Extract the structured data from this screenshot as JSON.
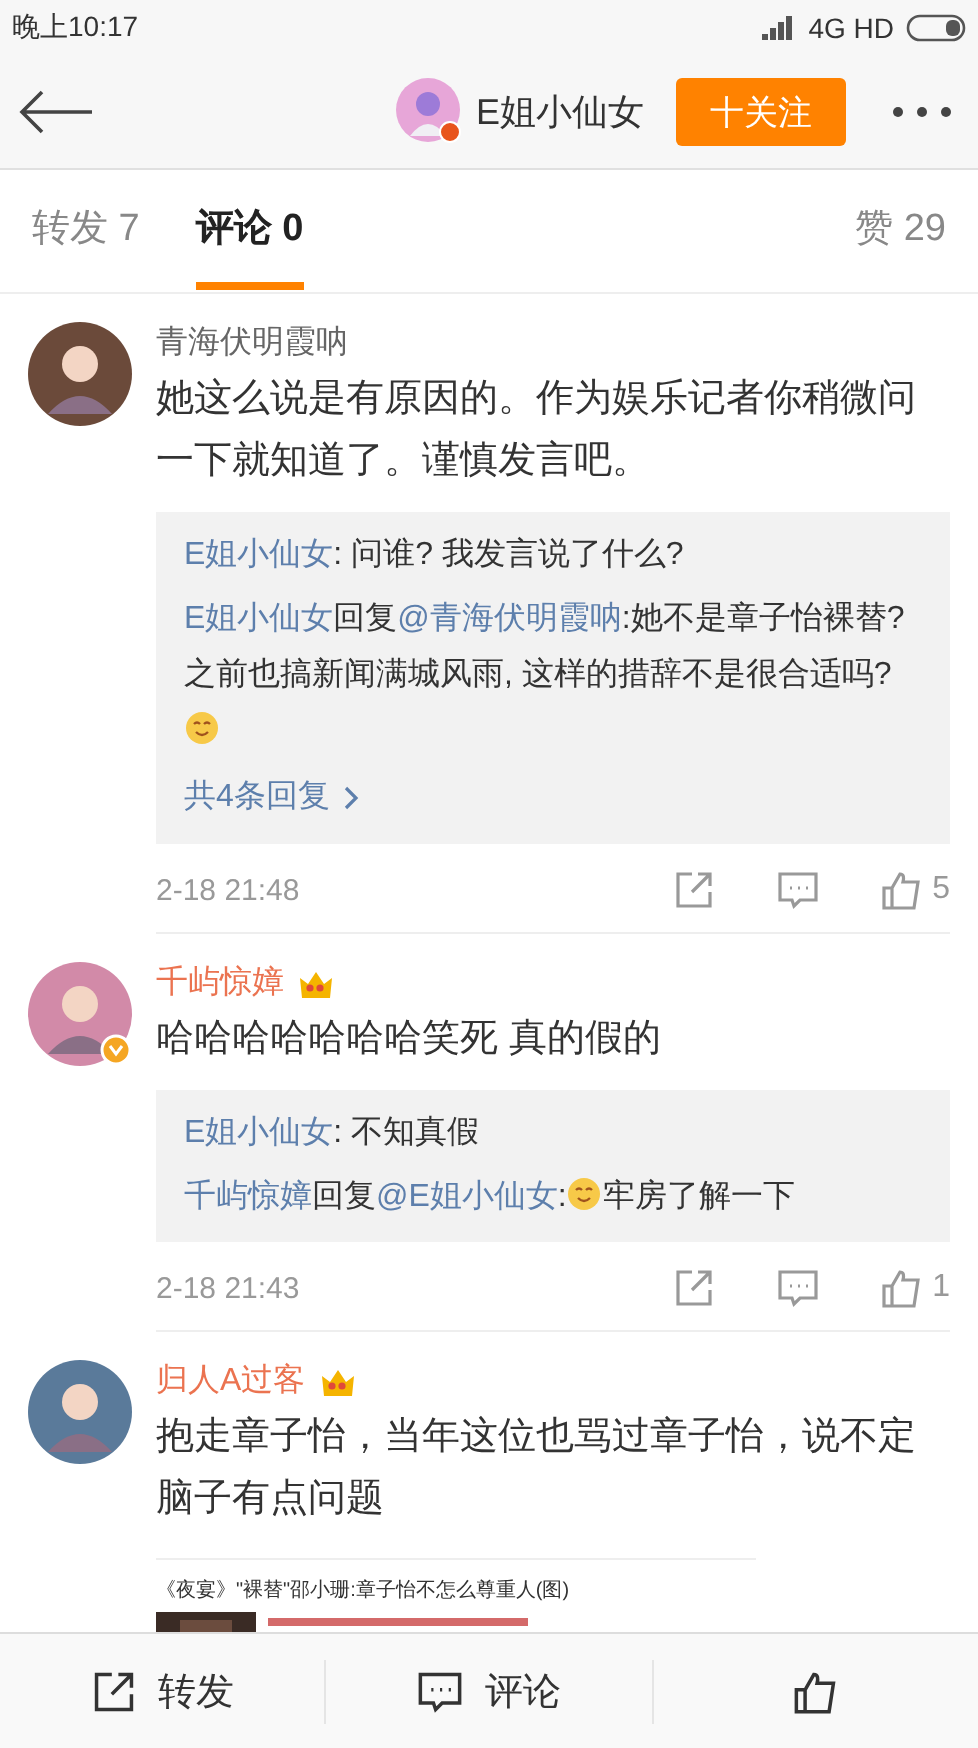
{
  "status_bar": {
    "time": "晚上10:17",
    "network": "4G HD"
  },
  "header": {
    "user": "E姐小仙女",
    "follow_button": "十关注"
  },
  "tabs": [
    {
      "label": "转发 7",
      "selected": false
    },
    {
      "label": "评论 0",
      "selected": true
    },
    {
      "label": "赞 29",
      "selected": false
    }
  ],
  "comments": [
    {
      "user": "青海伏明霞呐",
      "vip": false,
      "verified": false,
      "text": "她这么说是有原因的。作为娱乐记者你稍微问一下就知道了。谨慎发言吧。",
      "replies": [
        [
          {
            "kind": "link",
            "text": "E姐小仙女"
          },
          {
            "kind": "plain",
            "text": ": 问谁? 我发言说了什么?"
          }
        ],
        [
          {
            "kind": "link",
            "text": "E姐小仙女"
          },
          {
            "kind": "plain",
            "text": "回复"
          },
          {
            "kind": "link",
            "text": "@青海伏明霞呐"
          },
          {
            "kind": "plain",
            "text": ":她不是章子怡裸替? 之前也搞新闻满城风雨, 这样的措辞不是很合适吗?"
          },
          {
            "kind": "emoji"
          }
        ]
      ],
      "more": "共4条回复",
      "time": "2-18 21:48",
      "likes": "5"
    },
    {
      "user": "千屿惊嫜",
      "vip": true,
      "verified": true,
      "text": "哈哈哈哈哈哈哈笑死   真的假的",
      "replies": [
        [
          {
            "kind": "link",
            "text": "E姐小仙女"
          },
          {
            "kind": "plain",
            "text": ": 不知真假"
          }
        ],
        [
          {
            "kind": "link",
            "text": "千屿惊嫜"
          },
          {
            "kind": "plain",
            "text": "回复"
          },
          {
            "kind": "link",
            "text": "@E姐小仙女"
          },
          {
            "kind": "plain",
            "text": ":"
          },
          {
            "kind": "emoji"
          },
          {
            "kind": "plain",
            "text": "牢房了解一下"
          }
        ]
      ],
      "time": "2-18 21:43",
      "likes": "1"
    },
    {
      "user": "归人A过客",
      "vip": true,
      "verified": false,
      "text": "抱走章子怡，当年这位也骂过章子怡，说不定脑子有点问题",
      "attachment": {
        "title": "《夜宴》\"裸替\"邵小珊:章子怡不怎么尊重人(图)"
      }
    }
  ],
  "bottom_bar": [
    {
      "kind": "share",
      "label": "转发"
    },
    {
      "kind": "comment",
      "label": "评论"
    },
    {
      "kind": "like"
    }
  ]
}
